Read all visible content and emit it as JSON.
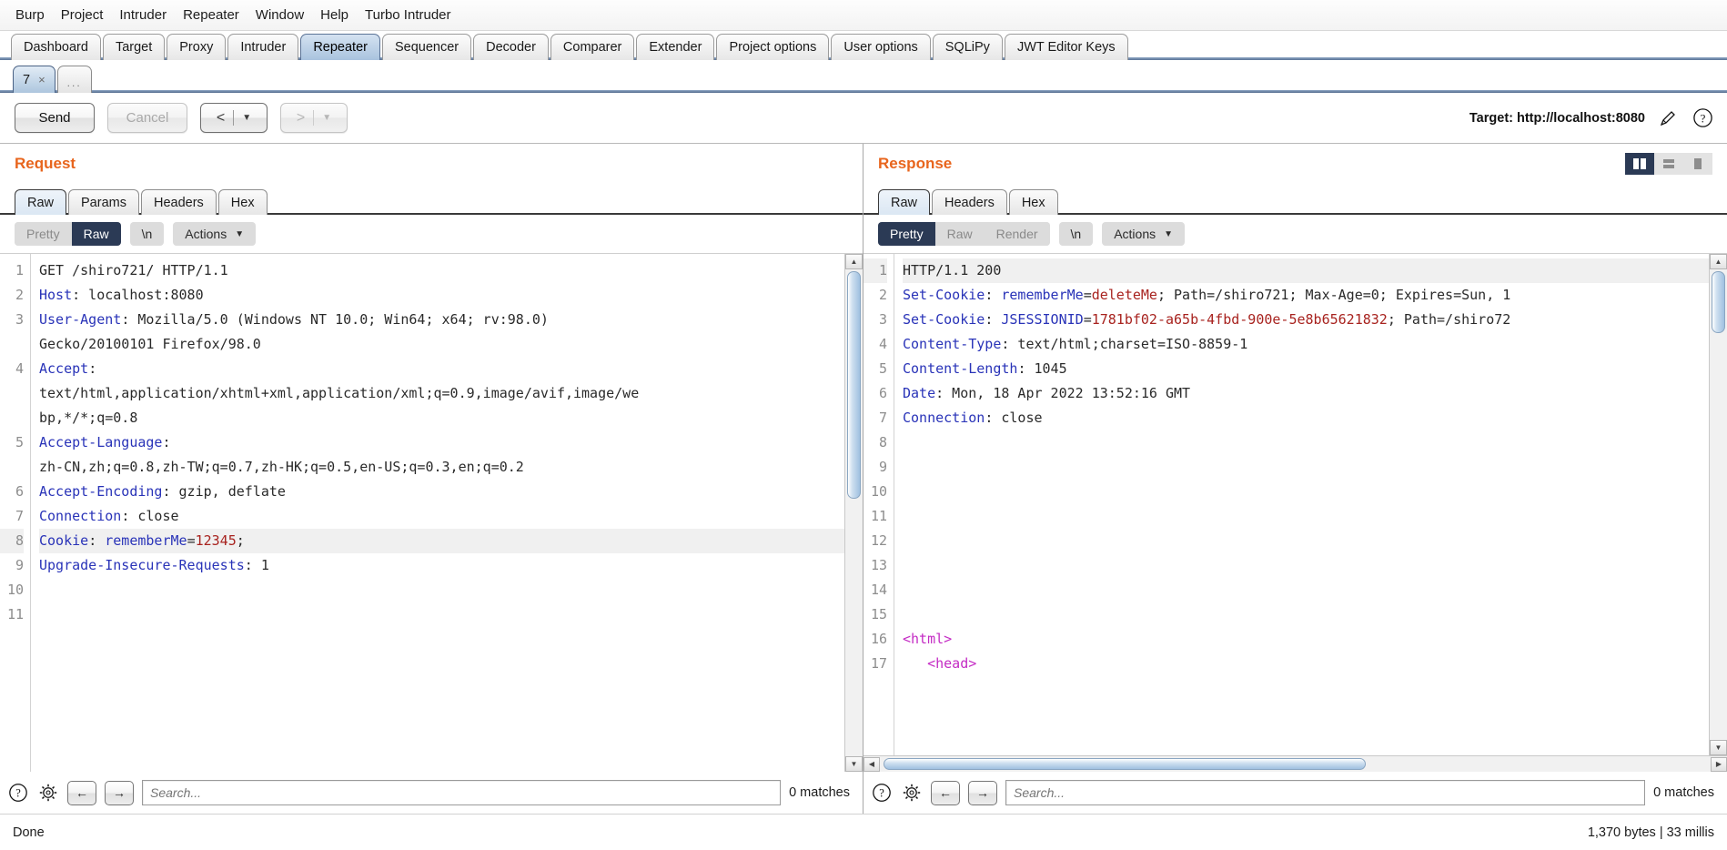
{
  "menu": {
    "items": [
      "Burp",
      "Project",
      "Intruder",
      "Repeater",
      "Window",
      "Help",
      "Turbo Intruder"
    ]
  },
  "main_tabs": [
    {
      "label": "Dashboard",
      "active": false
    },
    {
      "label": "Target",
      "active": false
    },
    {
      "label": "Proxy",
      "active": false
    },
    {
      "label": "Intruder",
      "active": false
    },
    {
      "label": "Repeater",
      "active": true
    },
    {
      "label": "Sequencer",
      "active": false
    },
    {
      "label": "Decoder",
      "active": false
    },
    {
      "label": "Comparer",
      "active": false
    },
    {
      "label": "Extender",
      "active": false
    },
    {
      "label": "Project options",
      "active": false
    },
    {
      "label": "User options",
      "active": false
    },
    {
      "label": "SQLiPy",
      "active": false
    },
    {
      "label": "JWT Editor Keys",
      "active": false
    }
  ],
  "repeater_tabs": [
    {
      "label": "7",
      "close": "×",
      "active": true
    },
    {
      "label": "...",
      "close": "",
      "active": false
    }
  ],
  "toolbar": {
    "send_label": "Send",
    "cancel_label": "Cancel",
    "back_arrow": "<",
    "forward_arrow": ">",
    "dropdown_caret": "▼",
    "target_label": "Target: http://localhost:8080",
    "edit_icon": "pencil-icon",
    "help_icon": "question-icon"
  },
  "request": {
    "title": "Request",
    "tabs": [
      {
        "label": "Raw",
        "active": true
      },
      {
        "label": "Params",
        "active": false
      },
      {
        "label": "Headers",
        "active": false
      },
      {
        "label": "Hex",
        "active": false
      }
    ],
    "modes": [
      {
        "label": "Pretty",
        "active": false
      },
      {
        "label": "Raw",
        "active": true
      }
    ],
    "newline_label": "\\n",
    "actions_label": "Actions",
    "lines": [
      {
        "num": "1",
        "hl": false,
        "parts": [
          {
            "t": "GET /shiro721/ HTTP/1.1",
            "c": "v"
          }
        ]
      },
      {
        "num": "2",
        "hl": false,
        "parts": [
          {
            "t": "Host",
            "c": "k"
          },
          {
            "t": ": localhost:8080",
            "c": "v"
          }
        ]
      },
      {
        "num": "3",
        "hl": false,
        "parts": [
          {
            "t": "User-Agent",
            "c": "k"
          },
          {
            "t": ": Mozilla/5.0 (Windows NT 10.0; Win64; x64; rv:98.0)",
            "c": "v"
          }
        ]
      },
      {
        "num": "",
        "hl": false,
        "parts": [
          {
            "t": "Gecko/20100101 Firefox/98.0",
            "c": "v"
          }
        ]
      },
      {
        "num": "4",
        "hl": false,
        "parts": [
          {
            "t": "Accept",
            "c": "k"
          },
          {
            "t": ":",
            "c": "v"
          }
        ]
      },
      {
        "num": "",
        "hl": false,
        "parts": [
          {
            "t": "text/html,application/xhtml+xml,application/xml;q=0.9,image/avif,image/we",
            "c": "v"
          }
        ]
      },
      {
        "num": "",
        "hl": false,
        "parts": [
          {
            "t": "bp,*/*;q=0.8",
            "c": "v"
          }
        ]
      },
      {
        "num": "5",
        "hl": false,
        "parts": [
          {
            "t": "Accept-Language",
            "c": "k"
          },
          {
            "t": ":",
            "c": "v"
          }
        ]
      },
      {
        "num": "",
        "hl": false,
        "parts": [
          {
            "t": "zh-CN,zh;q=0.8,zh-TW;q=0.7,zh-HK;q=0.5,en-US;q=0.3,en;q=0.2",
            "c": "v"
          }
        ]
      },
      {
        "num": "6",
        "hl": false,
        "parts": [
          {
            "t": "Accept-Encoding",
            "c": "k"
          },
          {
            "t": ": gzip, deflate",
            "c": "v"
          }
        ]
      },
      {
        "num": "7",
        "hl": false,
        "parts": [
          {
            "t": "Connection",
            "c": "k"
          },
          {
            "t": ": close",
            "c": "v"
          }
        ]
      },
      {
        "num": "8",
        "hl": true,
        "parts": [
          {
            "t": "Cookie",
            "c": "k"
          },
          {
            "t": ": ",
            "c": "v"
          },
          {
            "t": "rememberMe",
            "c": "k"
          },
          {
            "t": "=",
            "c": "v"
          },
          {
            "t": "12345",
            "c": "r"
          },
          {
            "t": ";",
            "c": "v"
          }
        ]
      },
      {
        "num": "9",
        "hl": false,
        "parts": [
          {
            "t": "Upgrade-Insecure-Requests",
            "c": "k"
          },
          {
            "t": ": 1",
            "c": "v"
          }
        ]
      },
      {
        "num": "10",
        "hl": false,
        "parts": [
          {
            "t": "",
            "c": "v"
          }
        ]
      },
      {
        "num": "11",
        "hl": false,
        "parts": [
          {
            "t": "",
            "c": "v"
          }
        ]
      }
    ],
    "find": {
      "placeholder": "Search...",
      "matches": "0 matches",
      "help_icon": "question-icon",
      "settings_icon": "gear-icon",
      "prev_icon": "←",
      "next_icon": "→"
    }
  },
  "response": {
    "title": "Response",
    "tabs": [
      {
        "label": "Raw",
        "active": true
      },
      {
        "label": "Headers",
        "active": false
      },
      {
        "label": "Hex",
        "active": false
      }
    ],
    "modes": [
      {
        "label": "Pretty",
        "active": true
      },
      {
        "label": "Raw",
        "active": false
      },
      {
        "label": "Render",
        "active": false
      }
    ],
    "newline_label": "\\n",
    "actions_label": "Actions",
    "view_modes": [
      {
        "name": "split-vertical-view",
        "active": true
      },
      {
        "name": "split-horizontal-view",
        "active": false
      },
      {
        "name": "single-pane-view",
        "active": false
      }
    ],
    "lines": [
      {
        "num": "1",
        "hl": true,
        "parts": [
          {
            "t": "HTTP/1.1 200",
            "c": "v"
          }
        ]
      },
      {
        "num": "2",
        "hl": false,
        "parts": [
          {
            "t": "Set-Cookie",
            "c": "k"
          },
          {
            "t": ": ",
            "c": "v"
          },
          {
            "t": "rememberMe",
            "c": "k"
          },
          {
            "t": "=",
            "c": "v"
          },
          {
            "t": "deleteMe",
            "c": "r"
          },
          {
            "t": "; Path=/shiro721; Max-Age=0; Expires=Sun, 1",
            "c": "v"
          }
        ]
      },
      {
        "num": "3",
        "hl": false,
        "parts": [
          {
            "t": "Set-Cookie",
            "c": "k"
          },
          {
            "t": ": ",
            "c": "v"
          },
          {
            "t": "JSESSIONID",
            "c": "k"
          },
          {
            "t": "=",
            "c": "v"
          },
          {
            "t": "1781bf02-a65b-4fbd-900e-5e8b65621832",
            "c": "r"
          },
          {
            "t": "; Path=/shiro72",
            "c": "v"
          }
        ]
      },
      {
        "num": "4",
        "hl": false,
        "parts": [
          {
            "t": "Content-Type",
            "c": "k"
          },
          {
            "t": ": text/html;charset=ISO-8859-1",
            "c": "v"
          }
        ]
      },
      {
        "num": "5",
        "hl": false,
        "parts": [
          {
            "t": "Content-Length",
            "c": "k"
          },
          {
            "t": ": 1045",
            "c": "v"
          }
        ]
      },
      {
        "num": "6",
        "hl": false,
        "parts": [
          {
            "t": "Date",
            "c": "k"
          },
          {
            "t": ": Mon, 18 Apr 2022 13:52:16 GMT",
            "c": "v"
          }
        ]
      },
      {
        "num": "7",
        "hl": false,
        "parts": [
          {
            "t": "Connection",
            "c": "k"
          },
          {
            "t": ": close",
            "c": "v"
          }
        ]
      },
      {
        "num": "8",
        "hl": false,
        "parts": [
          {
            "t": "",
            "c": "v"
          }
        ]
      },
      {
        "num": "9",
        "hl": false,
        "parts": [
          {
            "t": "",
            "c": "v"
          }
        ]
      },
      {
        "num": "10",
        "hl": false,
        "parts": [
          {
            "t": "",
            "c": "v"
          }
        ]
      },
      {
        "num": "11",
        "hl": false,
        "parts": [
          {
            "t": "",
            "c": "v"
          }
        ]
      },
      {
        "num": "12",
        "hl": false,
        "parts": [
          {
            "t": "",
            "c": "v"
          }
        ]
      },
      {
        "num": "13",
        "hl": false,
        "parts": [
          {
            "t": "",
            "c": "v"
          }
        ]
      },
      {
        "num": "14",
        "hl": false,
        "parts": [
          {
            "t": "",
            "c": "v"
          }
        ]
      },
      {
        "num": "15",
        "hl": false,
        "parts": [
          {
            "t": "",
            "c": "v"
          }
        ]
      },
      {
        "num": "16",
        "hl": false,
        "parts": [
          {
            "t": "<html>",
            "c": "m"
          }
        ]
      },
      {
        "num": "17",
        "hl": false,
        "parts": [
          {
            "t": "   <head>",
            "c": "m"
          }
        ]
      }
    ],
    "find": {
      "placeholder": "Search...",
      "matches": "0 matches",
      "help_icon": "question-icon",
      "settings_icon": "gear-icon",
      "prev_icon": "←",
      "next_icon": "→"
    }
  },
  "status": {
    "left": "Done",
    "right": "1,370 bytes | 33 millis"
  },
  "colors": {
    "accent_orange": "#e8651d",
    "key_blue": "#2933b8",
    "value_red": "#a8231f",
    "tag_magenta": "#c42bc4",
    "active_tab_blue": "#a9c3de",
    "mode_active": "#2b3a55"
  }
}
